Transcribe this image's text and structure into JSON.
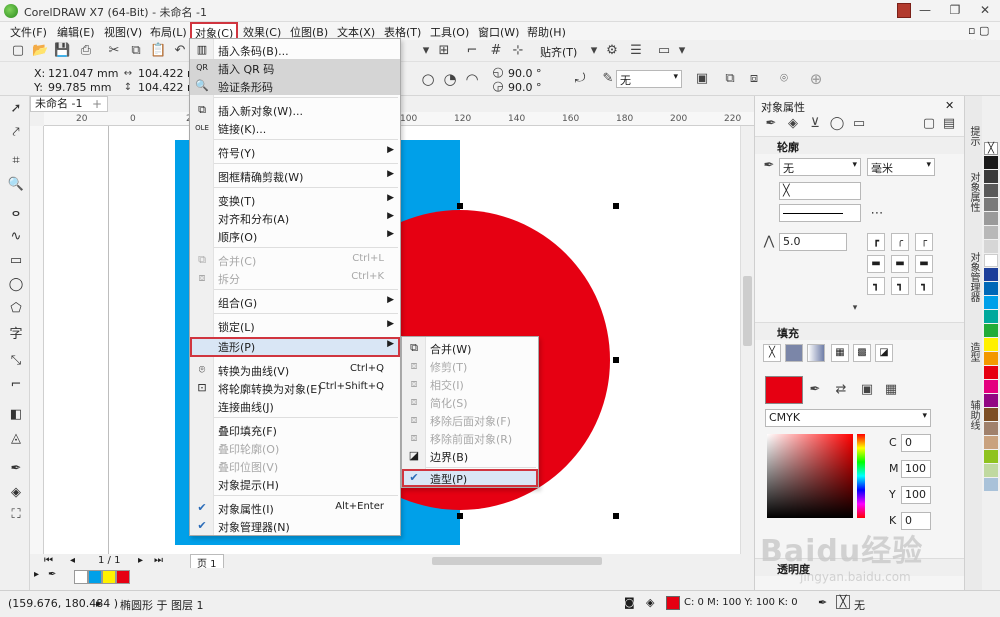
{
  "app": {
    "title": "CorelDRAW X7 (64-Bit) - 未命名 -1",
    "window_buttons": [
      "—",
      "❐",
      "✕"
    ]
  },
  "menubar": [
    {
      "label": "文件(F)"
    },
    {
      "label": "编辑(E)"
    },
    {
      "label": "视图(V)"
    },
    {
      "label": "布局(L)"
    },
    {
      "label": "对象(C)"
    },
    {
      "label": "效果(C)"
    },
    {
      "label": "位图(B)"
    },
    {
      "label": "文本(X)"
    },
    {
      "label": "表格(T)"
    },
    {
      "label": "工具(O)"
    },
    {
      "label": "窗口(W)"
    },
    {
      "label": "帮助(H)"
    }
  ],
  "toolbar": {
    "snap_label": "贴齐(T)",
    "x_label": "X:",
    "x_value": "121.047 mm",
    "y_label": "Y:",
    "y_value": "99.785 mm",
    "w_value": "104.422 mm",
    "h_value": "104.422 mm",
    "angle1": "90.0 °",
    "angle2": "90.0 °",
    "outline_none": "无"
  },
  "document": {
    "tab_label": "未命名 -1",
    "hruler": [
      "20",
      "0",
      "20",
      "40",
      "60",
      "80",
      "100",
      "120",
      "140",
      "160",
      "180",
      "200",
      "220"
    ],
    "page_nav": "1 / 1",
    "page_tab": "页 1"
  },
  "object_menu": {
    "items": [
      {
        "label": "插入条码(B)..."
      },
      {
        "label": "插入 QR 码"
      },
      {
        "label": "验证条形码"
      },
      {
        "label": "插入新对象(W)..."
      },
      {
        "label": "链接(K)..."
      },
      {
        "label": "符号(Y)"
      },
      {
        "label": "图框精确剪裁(W)"
      },
      {
        "label": "变换(T)"
      },
      {
        "label": "对齐和分布(A)"
      },
      {
        "label": "顺序(O)"
      },
      {
        "label": "合并(C)",
        "shortcut": "Ctrl+L"
      },
      {
        "label": "拆分",
        "shortcut": "Ctrl+K"
      },
      {
        "label": "组合(G)"
      },
      {
        "label": "锁定(L)"
      },
      {
        "label": "造形(P)"
      },
      {
        "label": "转换为曲线(V)",
        "shortcut": "Ctrl+Q"
      },
      {
        "label": "将轮廓转换为对象(E)",
        "shortcut": "Ctrl+Shift+Q"
      },
      {
        "label": "连接曲线(J)"
      },
      {
        "label": "叠印填充(F)"
      },
      {
        "label": "叠印轮廓(O)"
      },
      {
        "label": "叠印位图(V)"
      },
      {
        "label": "对象提示(H)"
      },
      {
        "label": "对象属性(I)",
        "shortcut": "Alt+Enter"
      },
      {
        "label": "对象管理器(N)"
      }
    ],
    "qr_prefix": "QR"
  },
  "shaping_menu": {
    "items": [
      {
        "label": "合并(W)"
      },
      {
        "label": "修剪(T)"
      },
      {
        "label": "相交(I)"
      },
      {
        "label": "简化(S)"
      },
      {
        "label": "移除后面对象(F)"
      },
      {
        "label": "移除前面对象(R)"
      },
      {
        "label": "边界(B)"
      },
      {
        "label": "造型(P)"
      }
    ]
  },
  "properties": {
    "title": "对象属性",
    "outline_section": "轮廓",
    "outline_width": "无",
    "outline_unit": "毫米",
    "miter": "5.0",
    "fill_section": "填充",
    "color_model": "CMYK",
    "c_label": "C",
    "c_value": "0",
    "m_label": "M",
    "m_value": "100",
    "y_label": "Y",
    "y_value": "100",
    "k_label": "K",
    "k_value": "0",
    "transparency_section": "透明度"
  },
  "dock_tabs": [
    "提示",
    "对象属性",
    "对象管理器",
    "造型",
    "辅助线"
  ],
  "status": {
    "coords": "(159.676, 180.484 )",
    "object_info": "椭圆形 于 图层 1",
    "fill_info": "C: 0 M: 100 Y: 100 K: 0",
    "outline_info": "无"
  },
  "colors": {
    "accent_red": "#e60012",
    "blue_rect": "#00a0e9",
    "highlight_border": "#d0353f"
  },
  "watermark": {
    "text": "Baidu经验",
    "url": "jingyan.baidu.com"
  }
}
